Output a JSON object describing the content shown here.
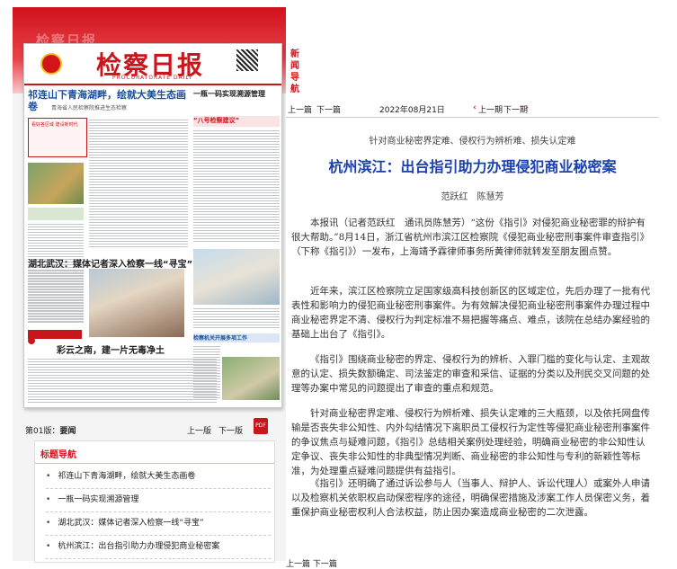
{
  "newspaper": {
    "masthead": "检察日报",
    "english": "PROCURATORATE DAILY",
    "headline_1": "祁连山下青海湖畔，绘就大美生态画卷",
    "subhead_1": "青海省人民检察院推进生态检察",
    "right_column_title": "一瓶一码实现溯源管理",
    "red_tag": "“八号检察建议”",
    "red_box": "看好各区域 建设新时代",
    "headline_2": "湖北武汉：媒体记者深入检察一线“寻宝”",
    "headline_3": "彩云之南，建一片无毒净土",
    "blue_tag": "检察机关开展多项工作"
  },
  "left_panel": {
    "edition_prefix": "第01版：",
    "edition_name": "要闻",
    "prev_page": "上一版",
    "next_page": "下一版",
    "pdf_label": "PDF",
    "nav_title": "标题导航",
    "nav_items": [
      "祁连山下青海湖畔，绘就大美生态画卷",
      "一瓶一码实现溯源管理",
      "湖北武汉：媒体记者深入检察一线“寻宝”",
      "杭州滨江：出台指引助力办理侵犯商业秘密案"
    ]
  },
  "side_label": "新闻导航",
  "article_nav": {
    "prev_article": "上一篇",
    "next_article": "下一篇",
    "date": "2022年08月21日",
    "prev_issue": "上一期",
    "next_issue": "下一期"
  },
  "article": {
    "kicker": "针对商业秘密界定难、侵权行为辨析难、损失认定难",
    "title": "杭州滨江：出台指引助力办理侵犯商业秘密案",
    "authors": "范跃红　陈慧芳",
    "paragraphs": [
      "本报讯（记者范跃红　通讯员陈慧芳）“这份《指引》对侵犯商业秘密罪的辩护有很大帮助。”8月14日，浙江省杭州市滨江区检察院《侵犯商业秘密刑事案件审查指引》（下称《指引》）一发布，上海靖予霖律师事务所黄律师就转发至朋友圈点赞。",
      "近年来，滨江区检察院立足国家级高科技创新区的区域定位，先后办理了一批有代表性和影响力的侵犯商业秘密刑事案件。为有效解决侵犯商业秘密刑事案件办理过程中商业秘密界定不清、侵权行为判定标准不易把握等痛点、难点，该院在总结办案经验的基础上出台了《指引》。",
      "《指引》围绕商业秘密的界定、侵权行为的辨析、入罪门槛的变化与认定、主观故意的认定、损失数额确定、司法鉴定的审查和采信、证据的分类以及刑民交叉问题的处理等办案中常见的问题提出了审查的重点和规范。",
      "针对商业秘密界定难、侵权行为辨析难、损失认定难的三大瓶颈，以及依托网盘传输是否丧失非公知性、内外勾结情况下离职员工侵权行为定性等侵犯商业秘密刑事案件的争议焦点与疑难问题，《指引》总结相关案例处理经验，明确商业秘密的非公知性认定争议、丧失非公知性的非典型情况判断、商业秘密的非公知性与专利的新颖性等标准，为处理重点疑难问题提供有益指引。",
      "《指引》还明确了通过诉讼参与人（当事人、辩护人、诉讼代理人）或案外人申请以及检察机关依职权启动保密程序的途径，明确保密措施及涉案工作人员保密义务，着重保护商业秘密权利人合法权益，防止因办案造成商业秘密的二次泄露。"
    ]
  },
  "bottom_nav": {
    "prev_article": "上一篇",
    "next_article": "下一篇"
  },
  "colors": {
    "brand_red": "#c8161d",
    "title_blue": "#1a3fb0"
  }
}
